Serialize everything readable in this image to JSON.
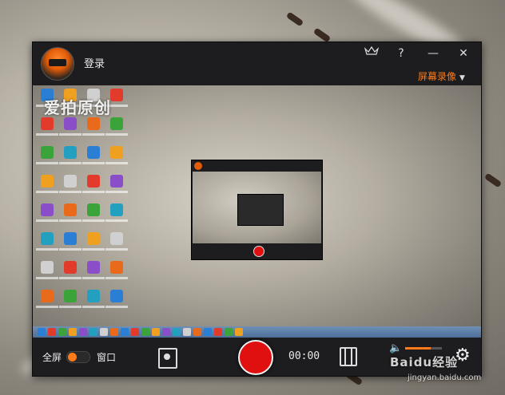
{
  "app": {
    "login_label": "登录",
    "vip_label": "VIP",
    "help_label": "?",
    "minimize_label": "—",
    "close_label": "✕",
    "mode_label": "屏幕录像",
    "mode_caret": "▼"
  },
  "preview": {
    "watermark": "爱拍原创"
  },
  "controls": {
    "fullscreen_label": "全屏",
    "window_label": "窗口",
    "timer": "00:00",
    "volume_level": 0.7,
    "speaker_icon": "🔈",
    "settings_icon": "⚙"
  },
  "brand": {
    "name": "Baidu经验",
    "url": "jingyan.baidu.com"
  },
  "colors": {
    "accent": "#ff7a18",
    "record": "#e01010",
    "panel": "#1d1d1f"
  }
}
